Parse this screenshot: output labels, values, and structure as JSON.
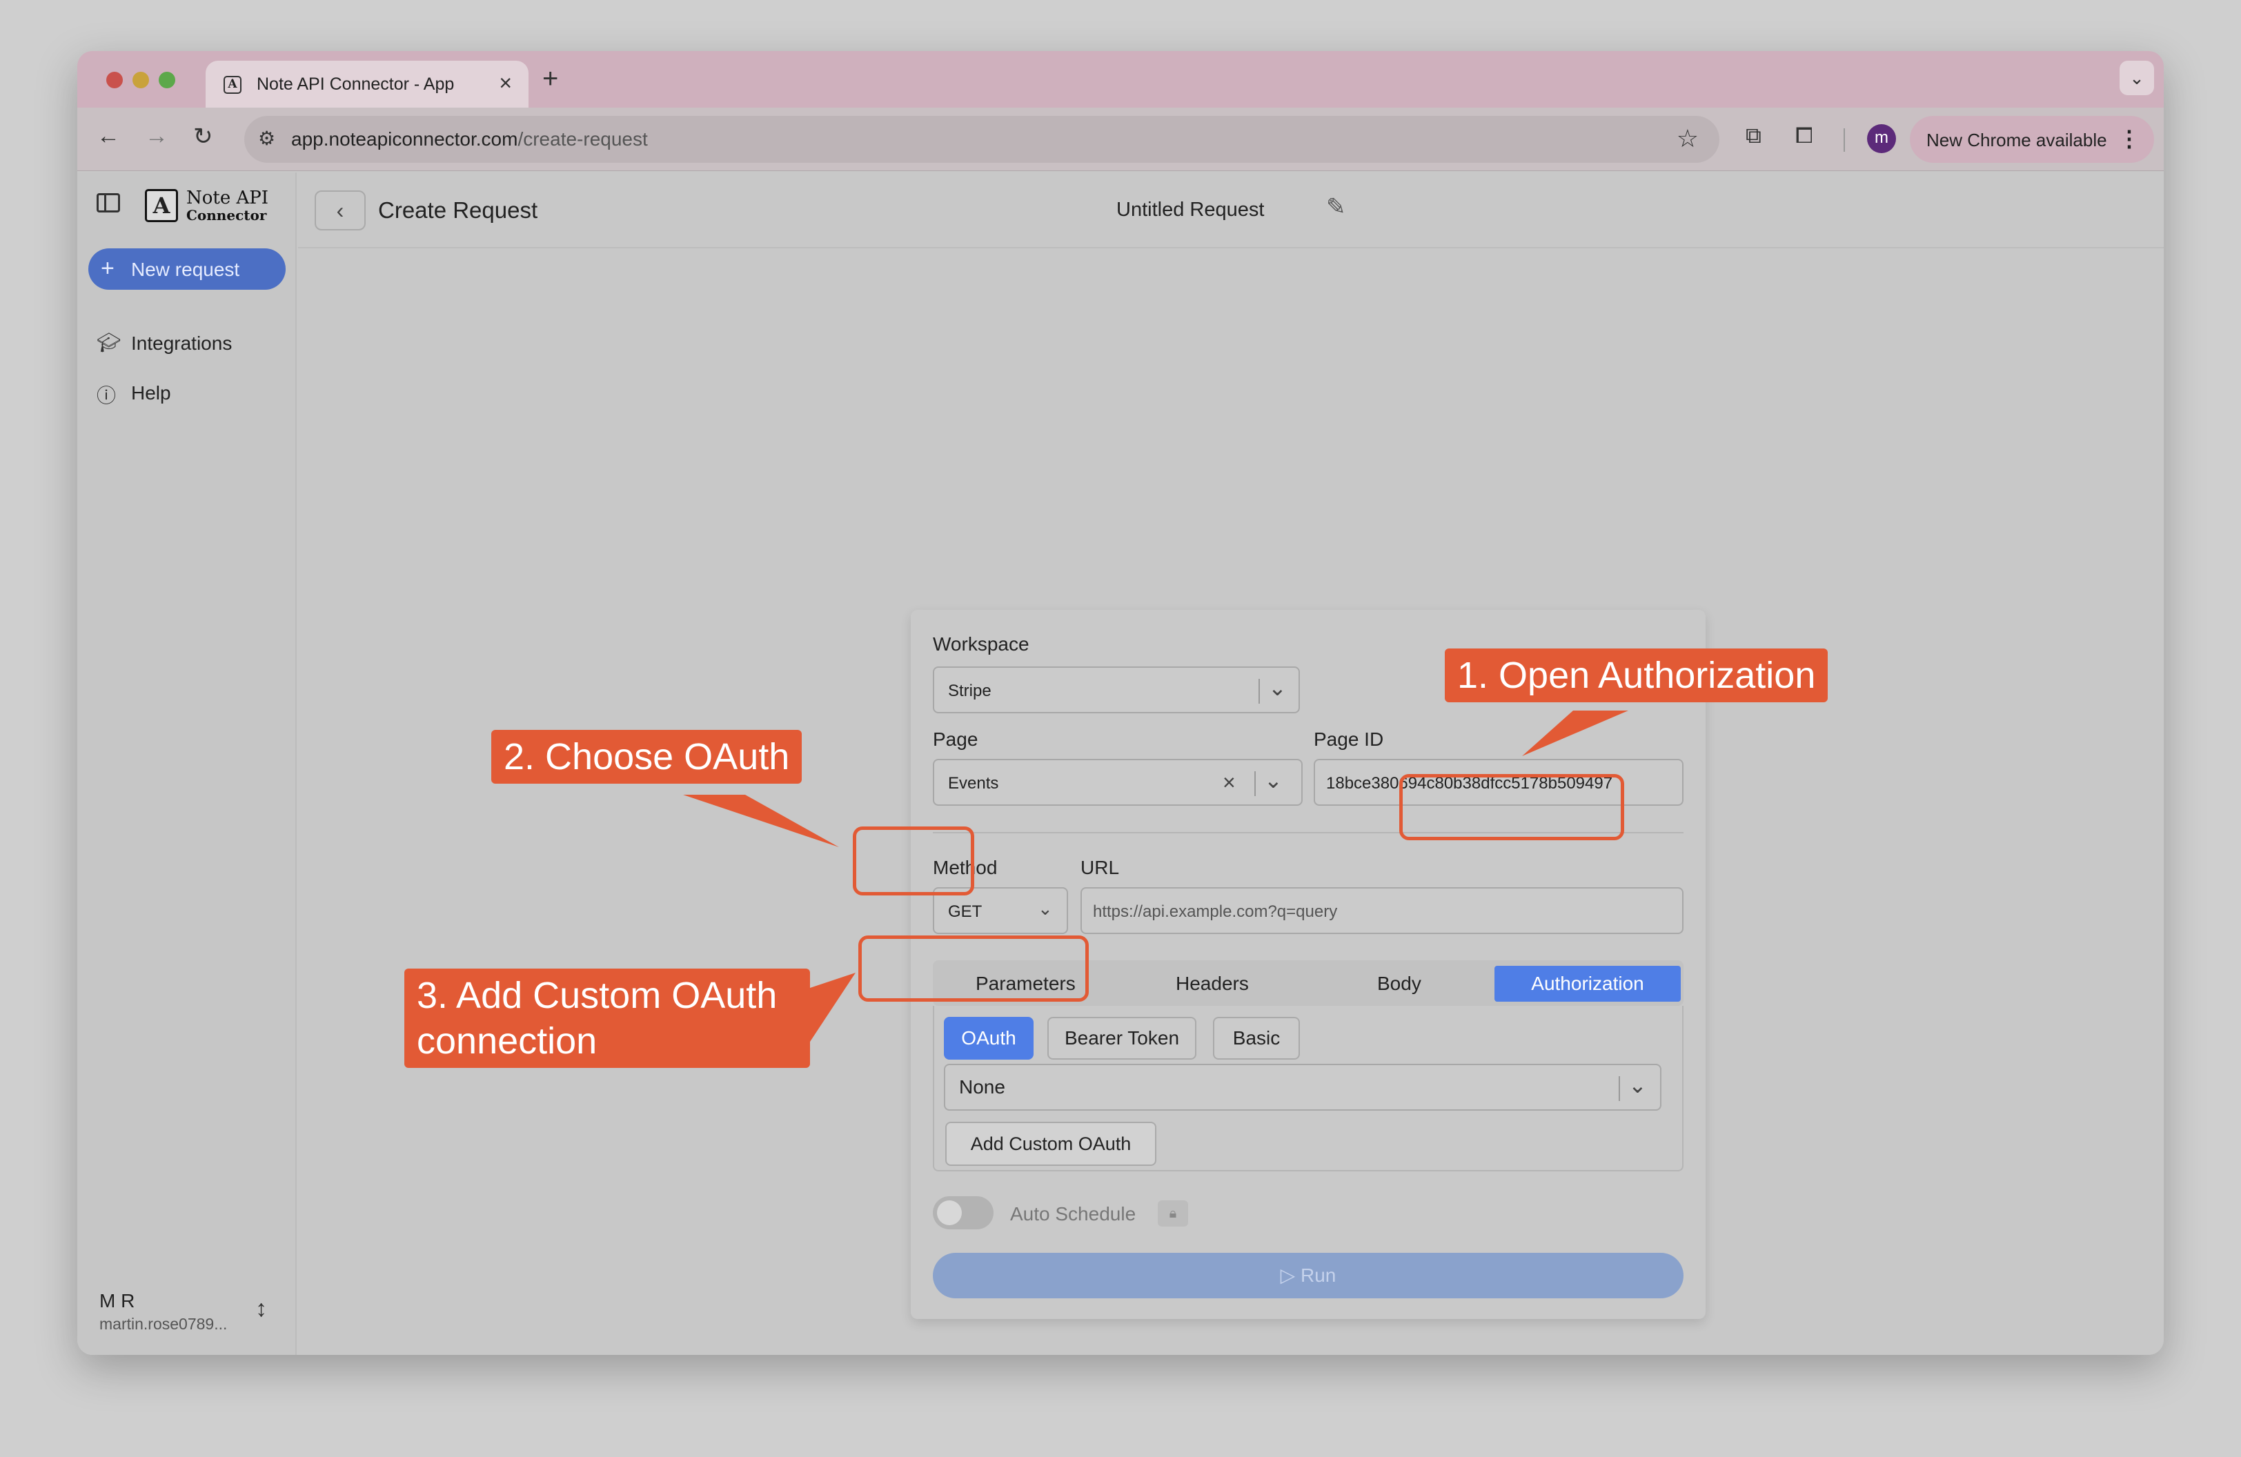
{
  "browser": {
    "tab_title": "Note API Connector - App",
    "tab_favicon": "A",
    "url_host": "app.noteapiconnector.com",
    "url_path": "/create-request",
    "profile_initial": "m",
    "update_pill": "New Chrome available"
  },
  "sidebar": {
    "logo_letter": "A",
    "logo_line1": "Note API",
    "logo_line2": "Connector",
    "new_request": "New request",
    "items": [
      {
        "label": "Integrations",
        "icon": "graduation-cap-icon"
      },
      {
        "label": "Help",
        "icon": "help-circle-icon"
      }
    ],
    "user_name": "M R",
    "user_email": "martin.rose0789..."
  },
  "header": {
    "title": "Create Request",
    "request_name": "Untitled Request"
  },
  "form": {
    "workspace_label": "Workspace",
    "workspace_value": "Stripe",
    "page_label": "Page",
    "page_value": "Events",
    "page_id_label": "Page ID",
    "page_id_value": "18bce380694c80b38dfcc5178b509497",
    "method_label": "Method",
    "method_value": "GET",
    "url_label": "URL",
    "url_placeholder": "https://api.example.com?q=query",
    "tabs": [
      "Parameters",
      "Headers",
      "Body",
      "Authorization"
    ],
    "auth_types": [
      "OAuth",
      "Bearer Token",
      "Basic"
    ],
    "oauth_connection": "None",
    "add_custom_oauth": "Add Custom OAuth",
    "auto_schedule": "Auto Schedule",
    "run": "Run"
  },
  "callouts": {
    "step1": "1. Open Authorization",
    "step2": "2. Choose OAuth",
    "step3_line1": "3. Add Custom OAuth",
    "step3_line2": "connection"
  },
  "colors": {
    "accent": "#4f7ee6",
    "callout": "#e25a35",
    "chat": "#2457a8"
  }
}
